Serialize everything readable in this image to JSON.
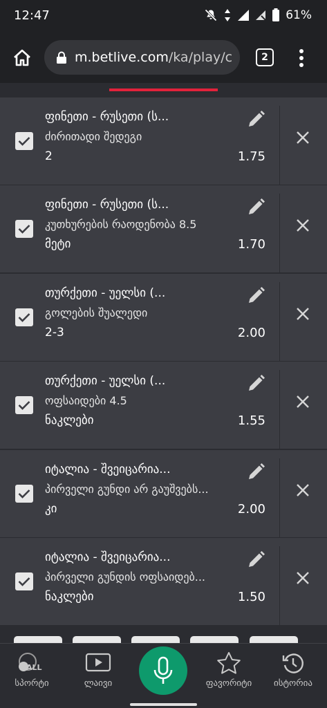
{
  "status_bar": {
    "time": "12:47",
    "battery": "61%",
    "icons": [
      "mute-icon",
      "data-arrows-icon",
      "signal-icon",
      "wifi-off-icon",
      "battery-icon"
    ]
  },
  "browser": {
    "url_host": "m.betlive.com",
    "url_path": "/ka/play/c",
    "tab_count": "2"
  },
  "bets": [
    {
      "title": "ფინეთი - რუსეთი (ს...",
      "market": "ძირითადი შედეგი",
      "pick": "2",
      "odds": "1.75",
      "checked": true
    },
    {
      "title": "ფინეთი - რუსეთი (ს...",
      "market": "კუთხურების რაოდენობა 8.5",
      "pick": "მეტი",
      "odds": "1.70",
      "checked": true
    },
    {
      "title": "თურქეთი - უელსი (...",
      "market": "გოლების შუალედი",
      "pick": "2-3",
      "odds": "2.00",
      "checked": true
    },
    {
      "title": "თურქეთი - უელსი (...",
      "market": "ოფსაიდები 4.5",
      "pick": "ნაკლები",
      "odds": "1.55",
      "checked": true
    },
    {
      "title": "იტალია - შვეიცარია...",
      "market": "პირველი გუნდი არ გაუშვებს...",
      "pick": "კი",
      "odds": "2.00",
      "checked": true
    },
    {
      "title": "იტალია - შვეიცარია...",
      "market": "პირველი გუნდის ოფსაიდებ...",
      "pick": "ნაკლები",
      "odds": "1.50",
      "checked": true
    }
  ],
  "bottom_nav": {
    "sports_icon_text": "ALL",
    "sports": "სპორტი",
    "live": "ლაივი",
    "favorites": "ფავორიტი",
    "history": "ისტორია"
  },
  "colors": {
    "accent": "#e2223b",
    "mic": "#0e9a6c",
    "card": "#3c3d43",
    "background": "#2b2c31"
  }
}
